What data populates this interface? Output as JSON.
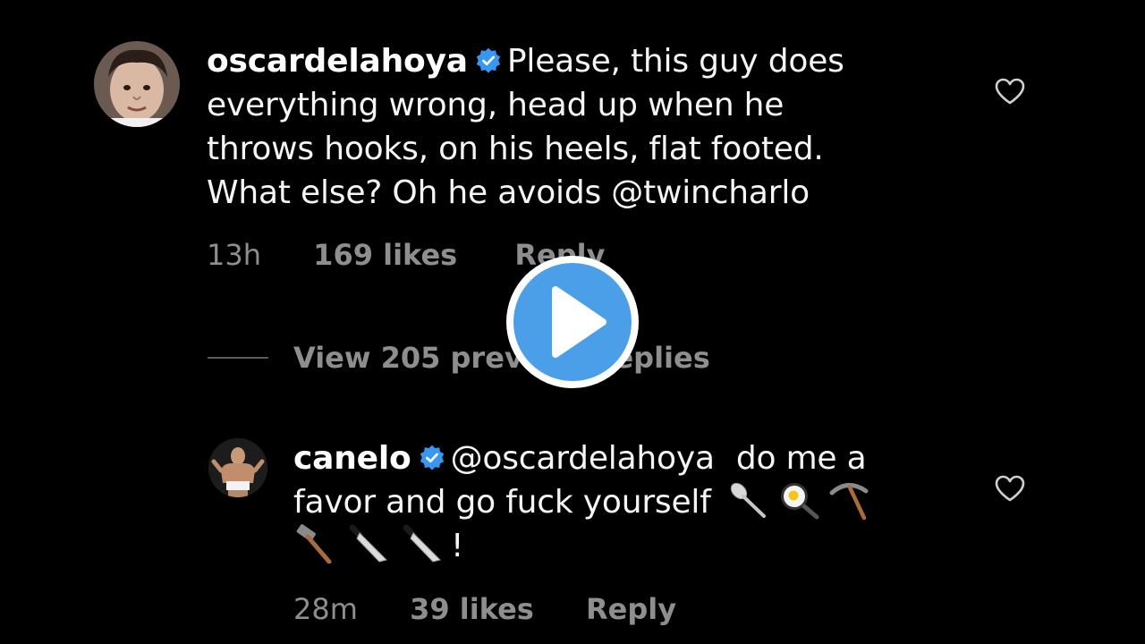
{
  "colors": {
    "background": "#000000",
    "text": "#f5f5f5",
    "muted": "#8e8e8e",
    "verified": "#3897f0",
    "play_fill": "#4a9fe8"
  },
  "comment_1": {
    "username": "oscardelahoya",
    "verified": true,
    "text_line_1": "Please, this guy does",
    "text_line_2": "everything wrong, head up when he",
    "text_line_3": "throws hooks, on his heels, flat footed.",
    "text_line_4": "What else? Oh he avoids @twincharlo",
    "time": "13h",
    "likes": "169 likes",
    "reply_label": "Reply",
    "heart_icon": "heart-outline-icon"
  },
  "view_replies": {
    "label": "View 205 previous replies"
  },
  "comment_2": {
    "username": "canelo",
    "verified": true,
    "mention": "@oscardelahoya",
    "text_line_1": "do me a",
    "text_line_2": "favor and go fuck yourself",
    "text_line_3_end": "!",
    "emojis_line_2": [
      "spoon-emoji",
      "frying-pan-egg-emoji",
      "pick-emoji"
    ],
    "emojis_line_3": [
      "hammer-emoji",
      "knife-emoji",
      "knife-emoji"
    ],
    "time": "28m",
    "likes": "39 likes",
    "reply_label": "Reply",
    "heart_icon": "heart-outline-icon"
  },
  "video_overlay": {
    "icon": "play-icon"
  }
}
